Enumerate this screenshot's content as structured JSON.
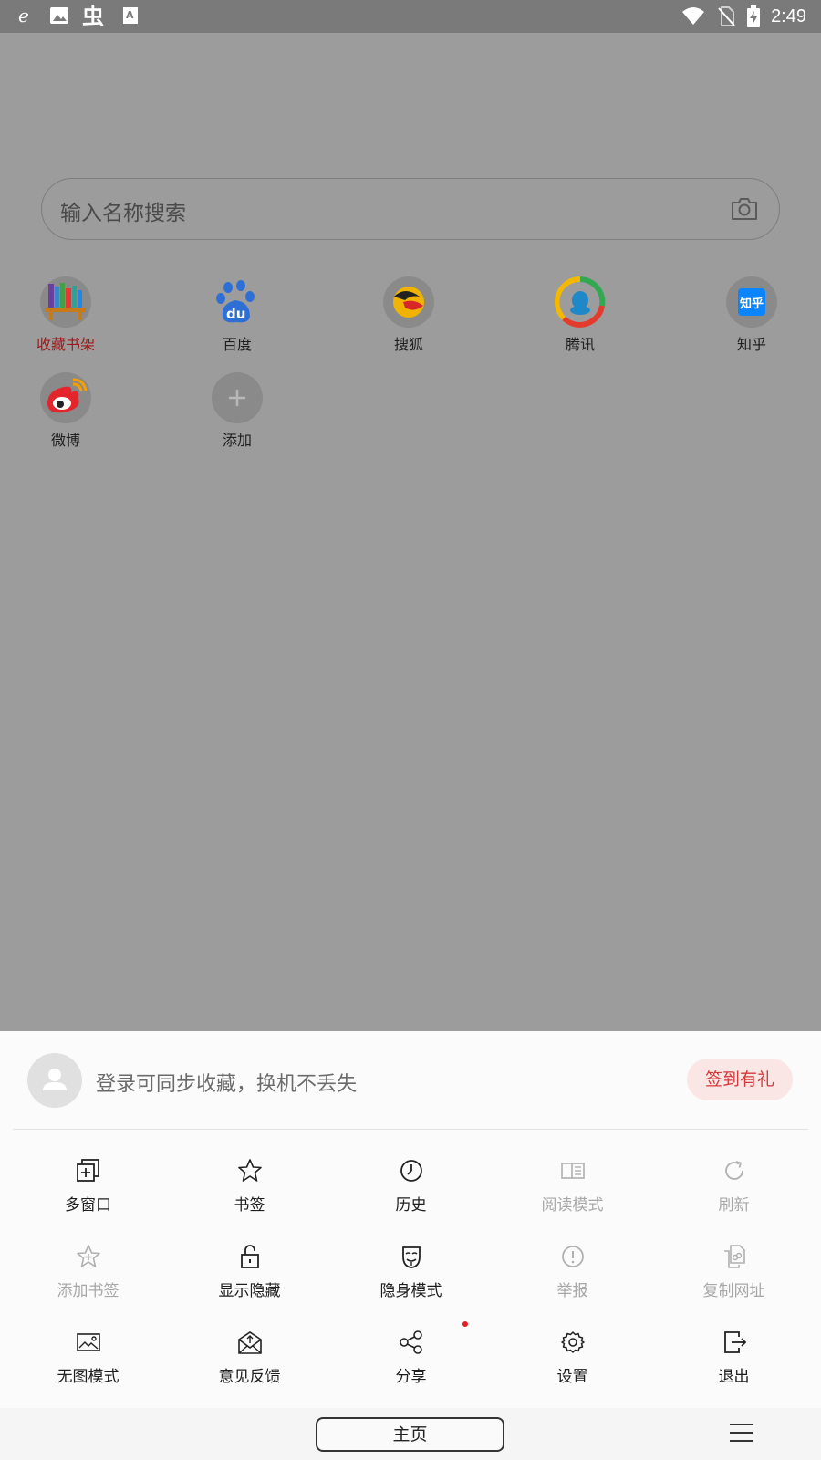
{
  "status_bar": {
    "time": "2:49",
    "left_icons": [
      "browser-e-icon",
      "image-icon",
      "bug-icon",
      "font-icon"
    ],
    "right_icons": [
      "wifi-icon",
      "no-sim-icon",
      "battery-charging-icon"
    ]
  },
  "search": {
    "placeholder": "输入名称搜索",
    "camera_icon": "camera-icon"
  },
  "shortcuts": [
    {
      "label": "收藏书架",
      "icon": "bookshelf-icon",
      "label_color": "#a11818"
    },
    {
      "label": "百度",
      "icon": "baidu-paw-icon"
    },
    {
      "label": "搜狐",
      "icon": "sohu-fox-icon"
    },
    {
      "label": "腾讯",
      "icon": "tencent-qq-icon"
    },
    {
      "label": "知乎",
      "icon": "zhihu-icon"
    },
    {
      "label": "微博",
      "icon": "weibo-icon"
    },
    {
      "label": "添加",
      "icon": "add-icon"
    }
  ],
  "account": {
    "login_prompt": "登录可同步收藏，换机不丢失",
    "signin_button": "签到有礼"
  },
  "menu": {
    "rows": [
      [
        {
          "label": "多窗口",
          "icon": "multi-window-icon",
          "enabled": true
        },
        {
          "label": "书签",
          "icon": "star-icon",
          "enabled": true
        },
        {
          "label": "历史",
          "icon": "clock-icon",
          "enabled": true
        },
        {
          "label": "阅读模式",
          "icon": "reading-mode-icon",
          "enabled": false
        },
        {
          "label": "刷新",
          "icon": "refresh-icon",
          "enabled": false
        }
      ],
      [
        {
          "label": "添加书签",
          "icon": "add-bookmark-icon",
          "enabled": false
        },
        {
          "label": "显示隐藏",
          "icon": "unlock-icon",
          "enabled": true
        },
        {
          "label": "隐身模式",
          "icon": "incognito-mask-icon",
          "enabled": true
        },
        {
          "label": "举报",
          "icon": "report-icon",
          "enabled": false
        },
        {
          "label": "复制网址",
          "icon": "copy-url-icon",
          "enabled": false
        }
      ],
      [
        {
          "label": "无图模式",
          "icon": "no-image-icon",
          "enabled": true
        },
        {
          "label": "意见反馈",
          "icon": "feedback-mail-icon",
          "enabled": true
        },
        {
          "label": "分享",
          "icon": "share-icon",
          "enabled": true
        },
        {
          "label": "设置",
          "icon": "gear-icon",
          "enabled": true
        },
        {
          "label": "退出",
          "icon": "exit-icon",
          "enabled": true
        }
      ]
    ]
  },
  "bottom_nav": {
    "home_label": "主页",
    "menu_icon": "hamburger-menu-icon"
  },
  "colors": {
    "overlay": "#9c9c9c",
    "accent_red": "#d43a3a",
    "signin_bg": "#fbe6e6",
    "disabled_text": "#a8a8a8"
  }
}
